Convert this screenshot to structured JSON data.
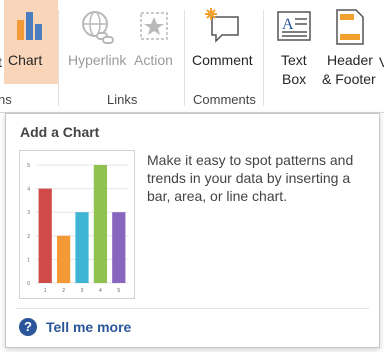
{
  "ribbon": {
    "left_cut_label": "t",
    "chart_label": "Chart",
    "hyperlink_label": "Hyperlink",
    "action_label": "Action",
    "comment_label": "Comment",
    "textbox_label_1": "Text",
    "textbox_label_2": "Box",
    "header_footer_label_1": "Header",
    "header_footer_label_2": "& Footer",
    "right_cut_label": "V",
    "groups": {
      "cut_group": "ns",
      "links": "Links",
      "comments": "Comments"
    }
  },
  "popup": {
    "title": "Add a Chart",
    "description": "Make it easy to spot patterns and trends in your data by inserting a bar, area, or line chart.",
    "help_label": "Tell me more",
    "help_icon_glyph": "?"
  },
  "chart_data": {
    "type": "bar",
    "categories": [
      "1",
      "2",
      "3",
      "4",
      "5"
    ],
    "values": [
      4,
      2,
      3,
      5,
      3
    ],
    "colors": [
      "#d04a4a",
      "#f39a36",
      "#3fb5d6",
      "#8fc24f",
      "#8866bf"
    ],
    "yticks": [
      "0",
      "1",
      "2",
      "3",
      "4",
      "5"
    ],
    "ylim": [
      0,
      5
    ]
  }
}
